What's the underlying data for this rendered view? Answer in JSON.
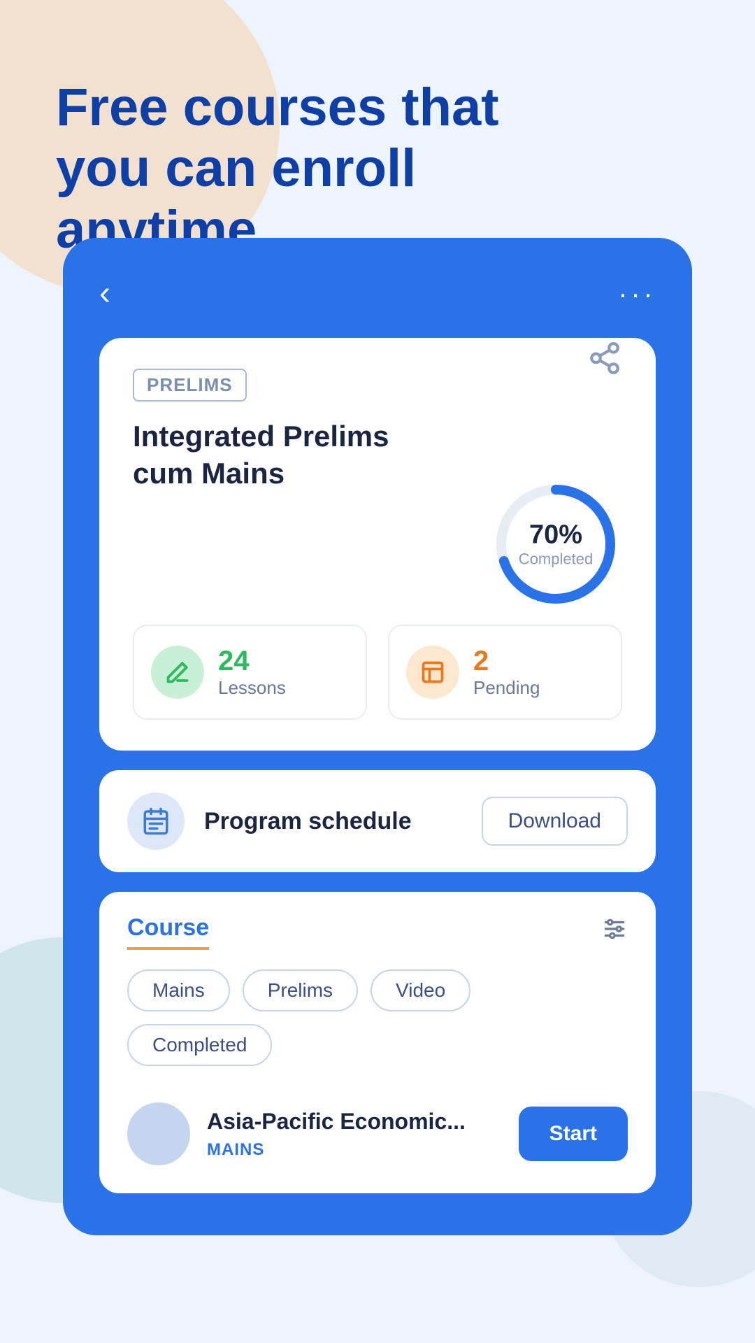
{
  "hero": {
    "title": "Free courses that you can enroll anytime"
  },
  "nav": {
    "back_icon": "‹",
    "dots_icon": "···"
  },
  "course": {
    "tag": "PRELIMS",
    "title": "Integrated Prelims cum Mains",
    "share_icon": "↗",
    "progress_percent": "70%",
    "progress_label": "Completed"
  },
  "stats": [
    {
      "icon": "✎",
      "number": "24",
      "label": "Lessons",
      "color": "green"
    },
    {
      "icon": "▤",
      "number": "2",
      "label": "Pending",
      "color": "orange"
    }
  ],
  "schedule": {
    "icon": "≡",
    "label": "Program schedule",
    "download_label": "Download"
  },
  "tabs": {
    "active_label": "Course",
    "filter_icon": "⚙",
    "chips": [
      "Mains",
      "Prelims",
      "Video",
      "Completed"
    ]
  },
  "course_item": {
    "title": "Asia-Pacific Economic...",
    "tag": "MAINS",
    "start_label": "Start"
  },
  "colors": {
    "blue": "#2972e8",
    "dark_blue": "#0d3fa6",
    "green": "#2bba5c",
    "orange": "#e87a1e"
  }
}
